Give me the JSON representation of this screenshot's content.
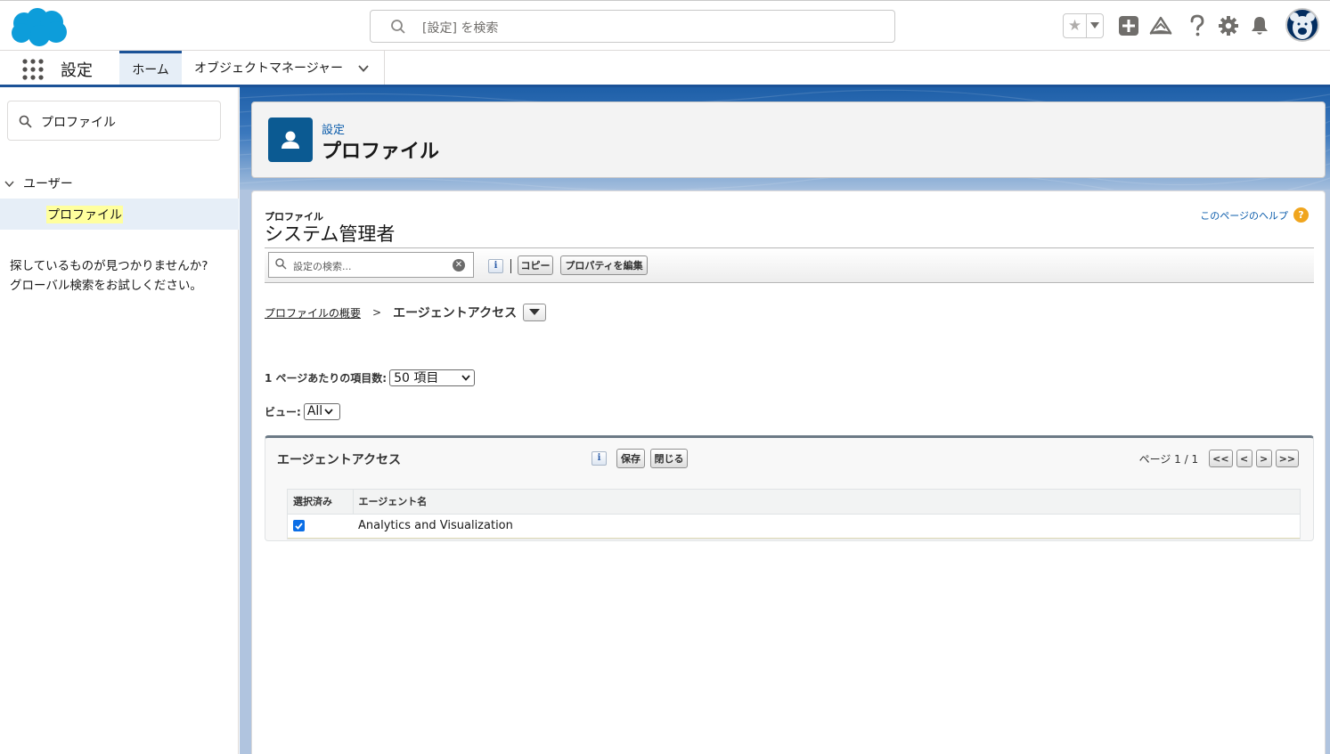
{
  "header": {
    "search_placeholder": "[設定] を検索"
  },
  "context_bar": {
    "app_name": "設定",
    "tabs": [
      {
        "label": "ホーム"
      },
      {
        "label": "オブジェクトマネージャー"
      }
    ]
  },
  "sidebar": {
    "quickfind_value": "プロファイル",
    "tree": {
      "parent_label": "ユーザー",
      "child_label": "プロファイル"
    },
    "not_found_line1": "探しているものが見つかりませんか?",
    "not_found_line2": "グローバル検索をお試しください。"
  },
  "page_header": {
    "breadcrumb": "設定",
    "title": "プロファイル"
  },
  "content": {
    "label": "プロファイル",
    "title": "システム管理者",
    "help_link": "このページのヘルプ",
    "help_icon_text": "?",
    "toolbar": {
      "search_placeholder": "設定の検索...",
      "info_text": "i",
      "copy_label": "コピー",
      "edit_props_label": "プロパティを編集"
    },
    "breadcrumb": {
      "link": "プロファイルの概要",
      "separator": ">",
      "current": "エージェントアクセス"
    },
    "per_page": {
      "label": "1 ページあたりの項目数:",
      "value": "50 項目"
    },
    "view": {
      "label": "ビュー:",
      "value": "All"
    },
    "panel": {
      "title": "エージェントアクセス",
      "info_text": "i",
      "save_label": "保存",
      "close_label": "閉じる",
      "page_info": "ページ 1 / 1",
      "first_label": "<<",
      "prev_label": "<",
      "next_label": ">",
      "last_label": ">>",
      "columns": [
        "選択済み",
        "エージェント名"
      ],
      "rows": [
        {
          "selected": true,
          "name": "Analytics and Visualization"
        }
      ]
    }
  },
  "colors": {
    "brand_blue": "#0b5cab",
    "header_icon_blue": "#0b5a92",
    "banner_blue": "#1e5fa8",
    "checkbox_blue": "#0b6ee6",
    "help_orange": "#f0a51e"
  }
}
